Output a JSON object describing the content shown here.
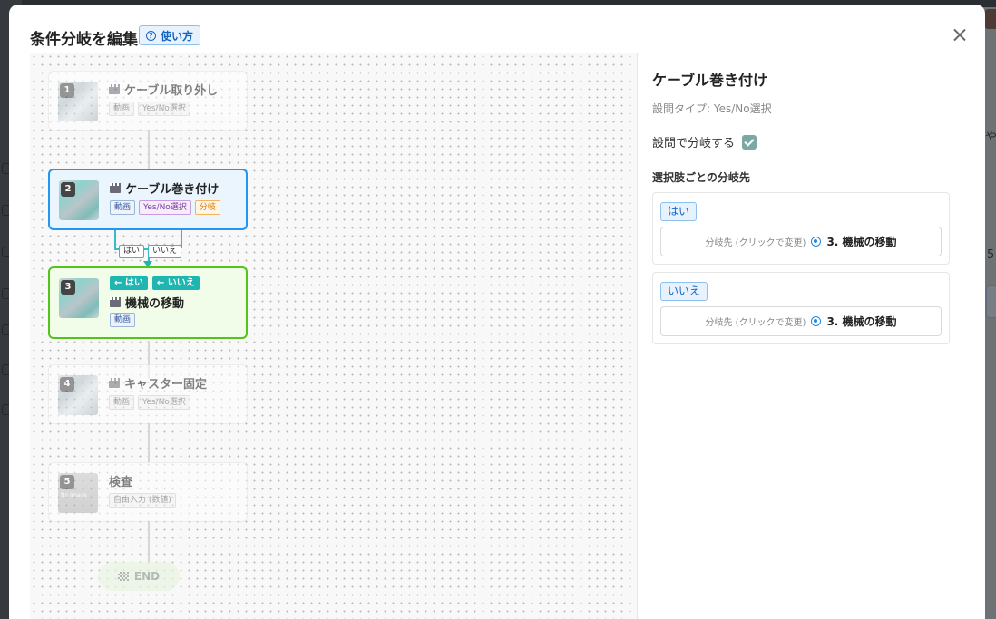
{
  "modal": {
    "title": "条件分岐を編集",
    "help_label": "使い方"
  },
  "background": {
    "right_text_1": "や",
    "right_text_2": "5"
  },
  "flow": {
    "nodes": [
      {
        "number": "1",
        "title": "ケーブル取り外し",
        "tags": [
          "動画",
          "Yes/No選択"
        ]
      },
      {
        "number": "2",
        "title": "ケーブル巻き付け",
        "tags": [
          "動画",
          "Yes/No選択",
          "分岐"
        ]
      },
      {
        "number": "3",
        "title": "機械の移動",
        "tags": [
          "動画"
        ],
        "incoming": [
          "← はい",
          "← いいえ"
        ]
      },
      {
        "number": "4",
        "title": "キャスター固定",
        "tags": [
          "動画",
          "Yes/No選択"
        ]
      },
      {
        "number": "5",
        "title": "検査",
        "tags": [
          "自由入力 (数値)"
        ],
        "thumb_caption": "No Image"
      }
    ],
    "branch_labels": [
      "はい",
      "いいえ"
    ],
    "end_label": "END"
  },
  "panel": {
    "title": "ケーブル巻き付け",
    "question_type": "設問タイプ: Yes/No選択",
    "branch_toggle_label": "設問で分岐する",
    "branch_enabled": true,
    "section_label": "選択肢ごとの分岐先",
    "options": [
      {
        "label": "はい",
        "hint": "分岐先 (クリックで変更)",
        "destination": "3. 機械の移動"
      },
      {
        "label": "いいえ",
        "hint": "分岐先 (クリックで変更)",
        "destination": "3. 機械の移動"
      }
    ]
  },
  "colors": {
    "selected_border": "#2196f3",
    "target_border": "#52c41a",
    "branch_teal": "#1fb5b0",
    "accent_blue": "#1565c0"
  }
}
